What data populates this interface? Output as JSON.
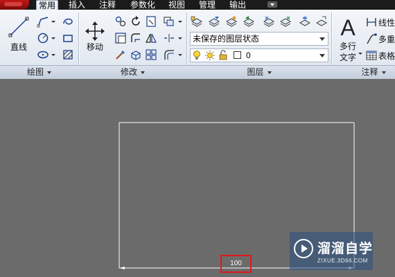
{
  "tabs": [
    {
      "label": "常用",
      "active": true
    },
    {
      "label": "插入",
      "active": false
    },
    {
      "label": "注释",
      "active": false
    },
    {
      "label": "参数化",
      "active": false
    },
    {
      "label": "视图",
      "active": false
    },
    {
      "label": "管理",
      "active": false
    },
    {
      "label": "输出",
      "active": false
    }
  ],
  "ribbon": {
    "draw": {
      "line_label": "直线",
      "panel_title": "绘图"
    },
    "modify": {
      "move_label": "移动",
      "panel_title": "修改"
    },
    "layers": {
      "layer_state": "未保存的图层状态",
      "current_layer": "0",
      "panel_title": "图层"
    },
    "annotation": {
      "mtext_label_1": "多行",
      "mtext_label_2": "文字",
      "linear_label": "线性",
      "multileader_label": "多重",
      "table_label": "表格",
      "panel_title": "注释"
    }
  },
  "drawing": {
    "dimension_value": "100",
    "highlight_color": "#e01818"
  },
  "watermark": {
    "title": "溜溜自学",
    "subtitle": "ZIXUE.3D66.COM"
  },
  "colors": {
    "canvas_background": "#6b6b6b",
    "line_color": "#ffffff",
    "ribbon_background": "#e2e8f0"
  }
}
